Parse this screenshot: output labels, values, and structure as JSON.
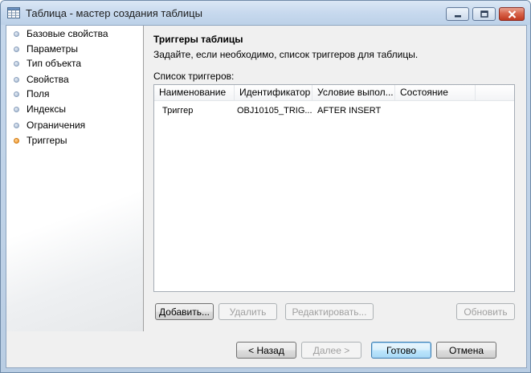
{
  "window": {
    "title": "Таблица - мастер создания таблицы"
  },
  "nav": {
    "items": [
      {
        "label": "Базовые свойства",
        "active": false
      },
      {
        "label": "Параметры",
        "active": false
      },
      {
        "label": "Тип объекта",
        "active": false
      },
      {
        "label": "Свойства",
        "active": false
      },
      {
        "label": "Поля",
        "active": false
      },
      {
        "label": "Индексы",
        "active": false
      },
      {
        "label": "Ограничения",
        "active": false
      },
      {
        "label": "Триггеры",
        "active": true
      }
    ]
  },
  "page": {
    "heading": "Триггеры таблицы",
    "subheading": "Задайте, если необходимо, список триггеров для таблицы.",
    "list_label": "Список триггеров:"
  },
  "table": {
    "columns": [
      "Наименование",
      "Идентификатор",
      "Условие выпол...",
      "Состояние"
    ],
    "rows": [
      [
        "Триггер",
        "OBJ10105_TRIG...",
        "AFTER INSERT",
        ""
      ]
    ]
  },
  "list_buttons": {
    "add": "Добавить...",
    "delete": "Удалить",
    "edit": "Редактировать...",
    "refresh": "Обновить"
  },
  "footer": {
    "back": "< Назад",
    "next": "Далее >",
    "finish": "Готово",
    "cancel": "Отмена"
  },
  "colors": {
    "active_bullet": "#f0901e",
    "close_button": "#c0391f"
  }
}
